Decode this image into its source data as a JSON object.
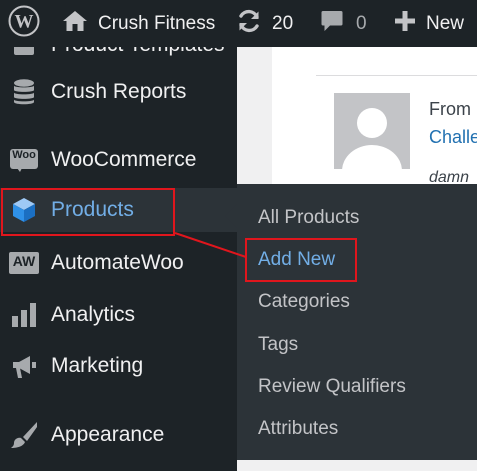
{
  "admin_bar": {
    "site_name": "Crush Fitness",
    "updates_count": "20",
    "comments_count": "0",
    "new_label": "New"
  },
  "sidebar": {
    "items": [
      {
        "label": "Product Templates",
        "icon": "document-icon"
      },
      {
        "label": "Crush Reports",
        "icon": "database-icon"
      },
      {
        "label": "WooCommerce",
        "icon": "woocommerce-icon",
        "icon_text": "Woo"
      },
      {
        "label": "Products",
        "icon": "cube-icon"
      },
      {
        "label": "AutomateWoo",
        "icon": "automatewoo-icon",
        "icon_text": "AW"
      },
      {
        "label": "Analytics",
        "icon": "bar-chart-icon"
      },
      {
        "label": "Marketing",
        "icon": "megaphone-icon"
      },
      {
        "label": "Appearance",
        "icon": "paintbrush-icon"
      }
    ]
  },
  "submenu": {
    "items": [
      {
        "label": "All Products"
      },
      {
        "label": "Add New"
      },
      {
        "label": "Categories"
      },
      {
        "label": "Tags"
      },
      {
        "label": "Review Qualifiers"
      },
      {
        "label": "Attributes"
      }
    ]
  },
  "content": {
    "from_text": "From",
    "link_text": "Challe",
    "snippet_text": "damn"
  },
  "colors": {
    "admin_bg": "#1d2327",
    "submenu_bg": "#2c3338",
    "accent_blue": "#72aee6",
    "highlight_red": "#e0161d"
  }
}
